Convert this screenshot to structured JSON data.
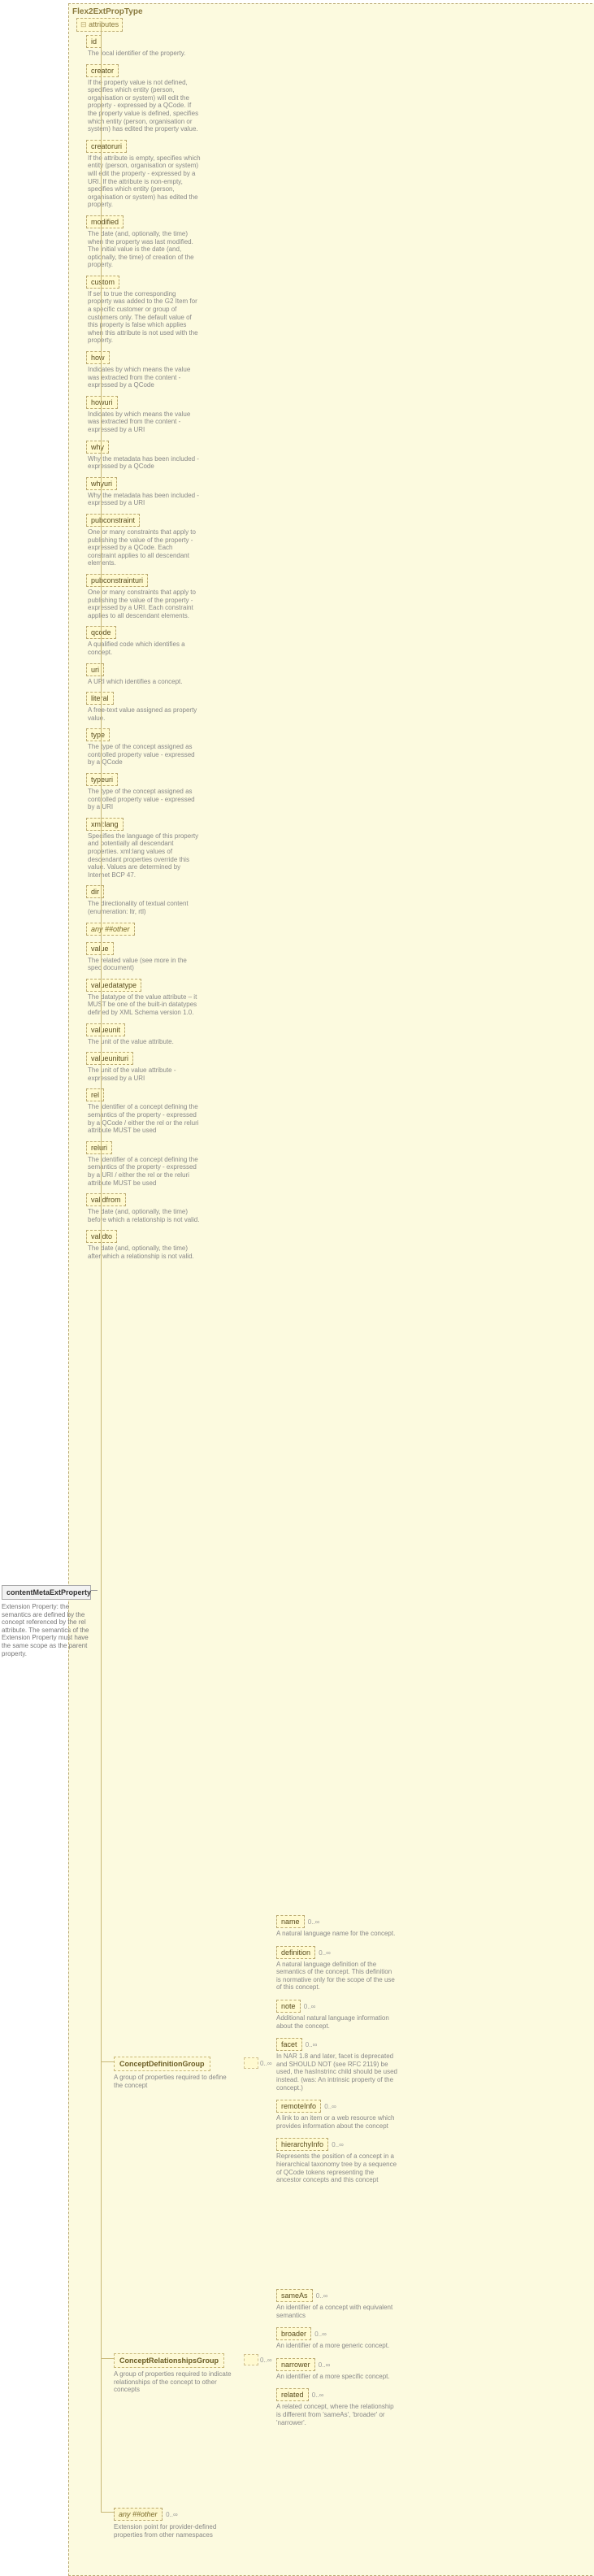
{
  "type_title": "Flex2ExtPropType",
  "root": {
    "name": "contentMetaExtProperty",
    "desc": "Extension Property: the semantics are defined by the concept referenced by the rel attribute. The semantics of the Extension Property must have the same scope as the parent property."
  },
  "attr_header": "attributes",
  "attributes": [
    {
      "name": "id",
      "opt": true,
      "desc": "The local identifier of the property."
    },
    {
      "name": "creator",
      "opt": true,
      "desc": "If the property value is not defined, specifies which entity (person, organisation or system) will edit the property - expressed by a QCode. If the property value is defined, specifies which entity (person, organisation or system) has edited the property value."
    },
    {
      "name": "creatoruri",
      "opt": true,
      "desc": "If the attribute is empty, specifies which entity (person, organisation or system) will edit the property - expressed by a URI. If the attribute is non-empty, specifies which entity (person, organisation or system) has edited the property."
    },
    {
      "name": "modified",
      "opt": true,
      "desc": "The date (and, optionally, the time) when the property was last modified. The initial value is the date (and, optionally, the time) of creation of the property."
    },
    {
      "name": "custom",
      "opt": true,
      "desc": "If set to true the corresponding property was added to the G2 Item for a specific customer or group of customers only. The default value of this property is false which applies when this attribute is not used with the property."
    },
    {
      "name": "how",
      "opt": true,
      "desc": "Indicates by which means the value was extracted from the content - expressed by a QCode"
    },
    {
      "name": "howuri",
      "opt": true,
      "desc": "Indicates by which means the value was extracted from the content - expressed by a URI"
    },
    {
      "name": "why",
      "opt": true,
      "desc": "Why the metadata has been included - expressed by a QCode"
    },
    {
      "name": "whyuri",
      "opt": true,
      "desc": "Why the metadata has been included - expressed by a URI"
    },
    {
      "name": "pubconstraint",
      "opt": true,
      "desc": "One or many constraints that apply to publishing the value of the property - expressed by a QCode. Each constraint applies to all descendant elements."
    },
    {
      "name": "pubconstrainturi",
      "opt": true,
      "desc": "One or many constraints that apply to publishing the value of the property - expressed by a URI. Each constraint applies to all descendant elements."
    },
    {
      "name": "qcode",
      "opt": true,
      "desc": "A qualified code which identifies a concept."
    },
    {
      "name": "uri",
      "opt": true,
      "desc": "A URI which identifies a concept."
    },
    {
      "name": "literal",
      "opt": true,
      "desc": "A free-text value assigned as property value."
    },
    {
      "name": "type",
      "opt": true,
      "desc": "The type of the concept assigned as controlled property value - expressed by a QCode"
    },
    {
      "name": "typeuri",
      "opt": true,
      "desc": "The type of the concept assigned as controlled property value - expressed by a URI"
    },
    {
      "name": "xml:lang",
      "opt": true,
      "desc": "Specifies the language of this property and potentially all descendant properties. xml:lang values of descendant properties override this value. Values are determined by Internet BCP 47."
    },
    {
      "name": "dir",
      "opt": true,
      "desc": "The directionality of textual content (enumeration: ltr, rtl)"
    },
    {
      "name": "any ##other",
      "opt": true,
      "desc": "",
      "any": true
    },
    {
      "name": "value",
      "opt": true,
      "desc": "The related value (see more in the spec document)"
    },
    {
      "name": "valuedatatype",
      "opt": true,
      "desc": "The datatype of the value attribute – it MUST be one of the built-in datatypes defined by XML Schema version 1.0."
    },
    {
      "name": "valueunit",
      "opt": true,
      "desc": "The unit of the value attribute."
    },
    {
      "name": "valueunituri",
      "opt": true,
      "desc": "The unit of the value attribute - expressed by a URI"
    },
    {
      "name": "rel",
      "opt": true,
      "desc": "The identifier of a concept defining the semantics of the property - expressed by a QCode / either the rel or the reluri attribute MUST be used"
    },
    {
      "name": "reluri",
      "opt": true,
      "desc": "The identifier of a concept defining the semantics of the property - expressed by a URI / either the rel or the reluri attribute MUST be used"
    },
    {
      "name": "validfrom",
      "opt": true,
      "desc": "The date (and, optionally, the time) before which a relationship is not valid."
    },
    {
      "name": "validto",
      "opt": true,
      "desc": "The date (and, optionally, the time) after which a relationship is not valid."
    }
  ],
  "groups": [
    {
      "name": "ConceptDefinitionGroup",
      "desc": "A group of properties required to define the concept",
      "children": [
        {
          "name": "name",
          "opt": true,
          "desc": "A natural language name for the concept."
        },
        {
          "name": "definition",
          "opt": true,
          "desc": "A natural language definition of the semantics of the concept. This definition is normative only for the scope of the use of this concept."
        },
        {
          "name": "note",
          "opt": true,
          "desc": "Additional natural language information about the concept."
        },
        {
          "name": "facet",
          "opt": true,
          "desc": "In NAR 1.8 and later, facet is deprecated and SHOULD NOT (see RFC 2119) be used, the hasInstrinc child should be used instead. (was: An intrinsic property of the concept.)"
        },
        {
          "name": "remoteInfo",
          "opt": true,
          "desc": "A link to an item or a web resource which provides information about the concept"
        },
        {
          "name": "hierarchyInfo",
          "opt": true,
          "desc": "Represents the position of a concept in a hierarchical taxonomy tree by a sequence of QCode tokens representing the ancestor concepts and this concept"
        }
      ]
    },
    {
      "name": "ConceptRelationshipsGroup",
      "desc": "A group of properties required to indicate relationships of the concept to other concepts",
      "children": [
        {
          "name": "sameAs",
          "opt": true,
          "desc": "An identifier of a concept with equivalent semantics"
        },
        {
          "name": "broader",
          "opt": true,
          "desc": "An identifier of a more generic concept."
        },
        {
          "name": "narrower",
          "opt": true,
          "desc": "An identifier of a more specific concept."
        },
        {
          "name": "related",
          "opt": true,
          "desc": "A related concept, where the relationship is different from 'sameAs', 'broader' or 'narrower'."
        }
      ]
    }
  ],
  "any_elem": {
    "name": "any ##other",
    "desc": "Extension point for provider-defined properties from other namespaces"
  },
  "occ": "0..∞"
}
